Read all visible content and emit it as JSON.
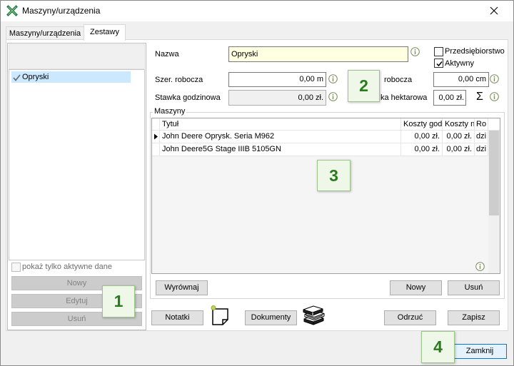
{
  "window": {
    "title": "Maszyny/urządzenia"
  },
  "tabs": [
    {
      "label": "Maszyny/urządzenia",
      "active": false
    },
    {
      "label": "Zestawy",
      "active": true
    }
  ],
  "left_panel": {
    "items": [
      {
        "label": "Opryski",
        "selected": true
      }
    ],
    "only_active_checkbox": {
      "label": "pokaż tylko aktywne dane",
      "checked": false,
      "enabled": false
    },
    "buttons": {
      "new": "Nowy",
      "edit": "Edytuj",
      "delete": "Usuń"
    }
  },
  "form": {
    "name": {
      "label": "Nazwa",
      "value": "Opryski"
    },
    "company_checkbox": {
      "label": "Przedsiębiorstwo",
      "checked": false
    },
    "active_checkbox": {
      "label": "Aktywny",
      "checked": true
    },
    "working_width": {
      "label": "Szer. robocza",
      "value": "0,00 m"
    },
    "working_speed": {
      "label": "robocza",
      "value": "0,00 cm"
    },
    "hourly_rate": {
      "label": "Stawka godzinowa",
      "value": "0,00 zł."
    },
    "hectare_rate": {
      "label": "ka hektarowa",
      "value": "0,00 zł."
    },
    "sum_symbol": "Σ"
  },
  "machines": {
    "group_label": "Maszyny",
    "columns": {
      "title": "Tytuł",
      "hourly_cost": "Koszty god",
      "n_cost": "Koszty n",
      "type": "Ro"
    },
    "rows": [
      {
        "title": "John Deere Oprysk. Seria M962",
        "hourly_cost": "0,00 zł.",
        "n_cost": "0,00 zł.",
        "type": "dzi",
        "current": true
      },
      {
        "title": "John Deere5G Stage IIIB 5105GN",
        "hourly_cost": "0,00 zł.",
        "n_cost": "0,00 zł.",
        "type": "dzi",
        "current": false
      }
    ],
    "buttons": {
      "align": "Wyrównaj",
      "new": "Nowy",
      "delete": "Usuń"
    }
  },
  "footer": {
    "notes": "Notatki",
    "documents": "Dokumenty",
    "discard": "Odrzuć",
    "save": "Zapisz"
  },
  "close_button": "Zamknij",
  "badges": [
    "1",
    "2",
    "3",
    "4"
  ],
  "icons": {
    "app": "excel-x-icon",
    "close": "close-icon",
    "list_item": "check-icon",
    "info": "info-icon",
    "row_indicator": "row-indicator-icon",
    "notes": "note-icon",
    "documents": "books-icon"
  },
  "colors": {
    "accent": "#0078d7",
    "selection": "#cce8ff",
    "name_field": "#ffffe1",
    "badge_fill": "#eef7e8",
    "badge_text": "#2b7a1d",
    "info_icon": "#7a8c5a"
  }
}
